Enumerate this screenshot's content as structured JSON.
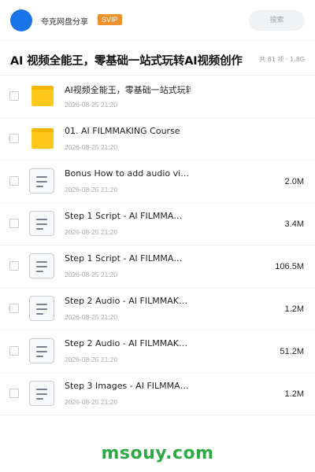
{
  "header": {
    "share_name": "夸克网盘分享",
    "badge": "SVIP",
    "search_placeholder": "搜索"
  },
  "title_bar": {
    "title": "AI 视频全能王，零基础一站式玩转AI视频创作",
    "summary": "共 81 项 · 1.8G"
  },
  "files": [
    {
      "type": "folder",
      "name": "AI视频全能王，零基础一站式玩转AI视频创作",
      "date": "2026-08-25 21:20",
      "size": ""
    },
    {
      "type": "folder",
      "name": "01. AI FILMMAKING Course",
      "date": "2026-08-25 21:20",
      "size": ""
    },
    {
      "type": "file",
      "name": "Bonus How to add audio vi…",
      "date": "2026-08-25 21:20",
      "size": "2.0M"
    },
    {
      "type": "file",
      "name": "Step 1 Script - AI FILMMA…",
      "date": "2026-08-25 21:20",
      "size": "3.4M"
    },
    {
      "type": "file",
      "name": "Step 1 Script - AI FILMMA…",
      "date": "2026-08-25 21:20",
      "size": "106.5M"
    },
    {
      "type": "file",
      "name": "Step 2 Audio - AI FILMMAK…",
      "date": "2026-08-25 21:20",
      "size": "1.2M"
    },
    {
      "type": "file",
      "name": "Step 2 Audio - AI FILMMAK…",
      "date": "2026-08-25 21:20",
      "size": "51.2M"
    },
    {
      "type": "file",
      "name": "Step 3 Images - AI FILMMA…",
      "date": "2026-08-25 21:20",
      "size": "1.2M"
    }
  ],
  "watermark": "msouy.com",
  "colors": {
    "avatar": "#1a73e8",
    "badge": "#f0922b",
    "folder": "#ffc81a",
    "watermark": "#2eaa44"
  }
}
